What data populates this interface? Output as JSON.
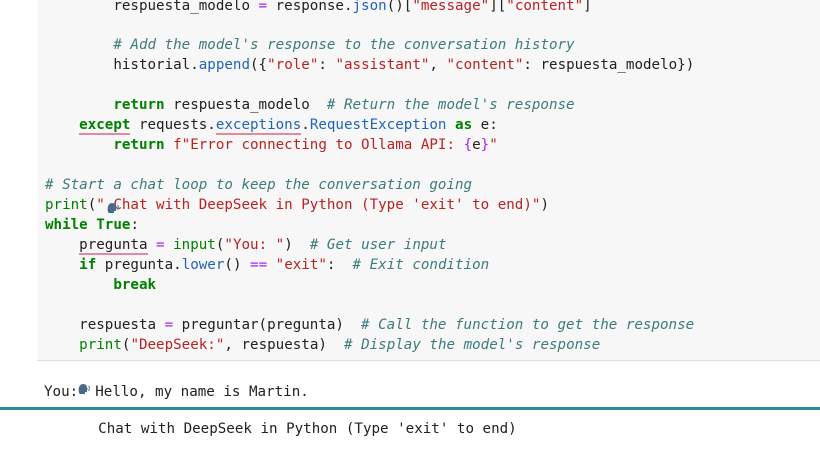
{
  "code": {
    "line1": {
      "indent": "        ",
      "var": "respuesta_modelo",
      "eq": " = ",
      "obj": "response.",
      "fn": "json",
      "rest": "()[",
      "s1": "\"message\"",
      "mid": "][",
      "s2": "\"content\"",
      "end": "]"
    },
    "line3_comment": "# Add the model's response to the conversation history",
    "line4": {
      "obj": "historial.",
      "fn": "append",
      "open": "({",
      "k1": "\"role\"",
      "c1": ": ",
      "v1": "\"assistant\"",
      "sep": ", ",
      "k2": "\"content\"",
      "c2": ": ",
      "v2": "respuesta_modelo",
      "close": "})"
    },
    "line6": {
      "kw": "return",
      "rest": " respuesta_modelo  ",
      "comment": "# Return the model's response"
    },
    "line7": {
      "kw": "except",
      "mod": " requests.",
      "attr": "exceptions",
      "dot": ".",
      "cls": "RequestException",
      "as": " as ",
      "var": "e:"
    },
    "line8": {
      "kw": "return",
      "sp": " ",
      "fstr": "f\"Error connecting to Ollama API: ",
      "brace_open": "{",
      "evar": "e",
      "brace_close": "}",
      "fend": "\""
    },
    "line10_comment": "# Start a chat loop to keep the conversation going",
    "line11": {
      "fn": "print",
      "open": "(",
      "str": "\" Chat with DeepSeek in Python (Type 'exit' to end)\"",
      "close": ")"
    },
    "line12": {
      "kw": "while",
      "sp": " ",
      "val": "True",
      "colon": ":"
    },
    "line13": {
      "var": "pregunta",
      "eq": " = ",
      "fn": "input",
      "open": "(",
      "str": "\"You: \"",
      "close": ")  ",
      "comment": "# Get user input"
    },
    "line14": {
      "kw": "if",
      "rest": " pregunta.",
      "fn": "lower",
      "paren": "() ",
      "op": "==",
      "sp": " ",
      "str": "\"exit\"",
      "colon": ":  ",
      "comment": "# Exit condition"
    },
    "line15": {
      "kw": "break"
    },
    "line17": {
      "var": "respuesta",
      "eq": " = ",
      "rest": "preguntar(pregunta)  ",
      "comment": "# Call the function to get the response"
    },
    "line18": {
      "fn": "print",
      "open": "(",
      "str": "\"DeepSeek:\"",
      "rest": ", respuesta)  ",
      "comment": "# Display the model's response"
    }
  },
  "output": {
    "line1": "Chat with DeepSeek in Python (Type 'exit' to end)",
    "line2": "You:  Hello, my name is Martin."
  },
  "colors": {
    "keyword": "#008000",
    "comment": "#3d7b7b",
    "string": "#ba2121",
    "function": "#1f63b8",
    "cell_bg": "#f7f7f7",
    "accent_bar": "#2a8a9a"
  },
  "icons": {
    "speaking_head": "speaking-head-icon"
  }
}
